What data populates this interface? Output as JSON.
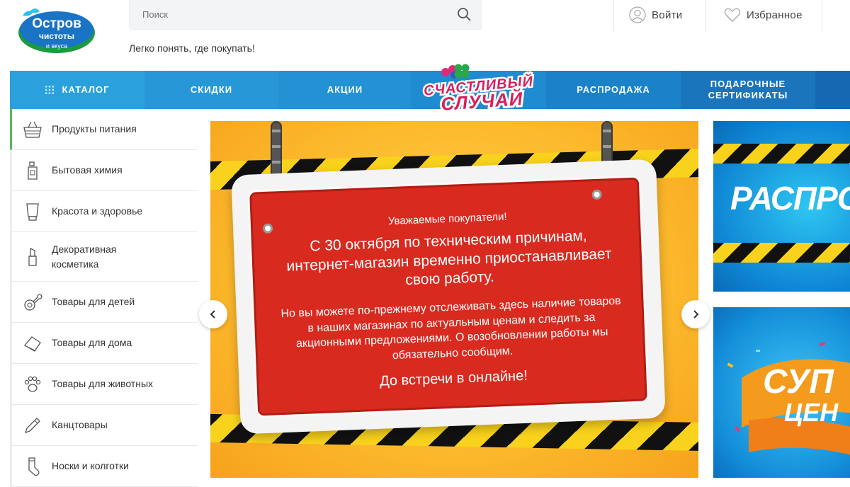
{
  "logo": {
    "line1": "Остров",
    "line2": "чистоты",
    "line3": "и вкуса"
  },
  "search": {
    "placeholder": "Поиск"
  },
  "tagline": "Легко понять, где покупать!",
  "header_actions": {
    "login": "Войти",
    "favorites": "Избранное"
  },
  "nav": {
    "catalog": "Каталог",
    "discounts": "Скидки",
    "promos": "Акции",
    "lucky_line1": "Счастливый",
    "lucky_line2": "случай",
    "sale": "Распродажа",
    "certificates_line1": "Подарочные",
    "certificates_line2": "сертификаты"
  },
  "sidebar": {
    "items": [
      {
        "label": "Продукты питания",
        "icon": "basket-icon"
      },
      {
        "label": "Бытовая химия",
        "icon": "bottle-icon"
      },
      {
        "label": "Красота и здоровье",
        "icon": "tube-icon"
      },
      {
        "label": "Декоративная косметика",
        "icon": "lipstick-icon"
      },
      {
        "label": "Товары для детей",
        "icon": "pacifier-icon"
      },
      {
        "label": "Товары для дома",
        "icon": "cleaning-icon"
      },
      {
        "label": "Товары для животных",
        "icon": "paw-icon"
      },
      {
        "label": "Канцтовары",
        "icon": "pencil-icon"
      },
      {
        "label": "Носки и колготки",
        "icon": "sock-icon"
      }
    ]
  },
  "banner": {
    "greeting": "Уважаемые покупатели!",
    "main": "С 30 октября по техническим причинам, интернет-магазин временно приостанавливает свою работу.",
    "sub": "Но вы можете по-прежнему отслеживать здесь наличие товаров в наших магазинах по актуальным ценам и следить за акционными предложениями. О возобновлении работы мы обязательно сообщим.",
    "closing": "До встречи в онлайне!"
  },
  "side_banners": {
    "first": "РАСПРОД",
    "second_line1": "СУП",
    "second_line2": "ЦЕН"
  },
  "colors": {
    "nav_blue": "#2391d3",
    "sign_red": "#d92a1f",
    "banner_yellow": "#fcb92c",
    "active_green": "#5bb85b"
  }
}
